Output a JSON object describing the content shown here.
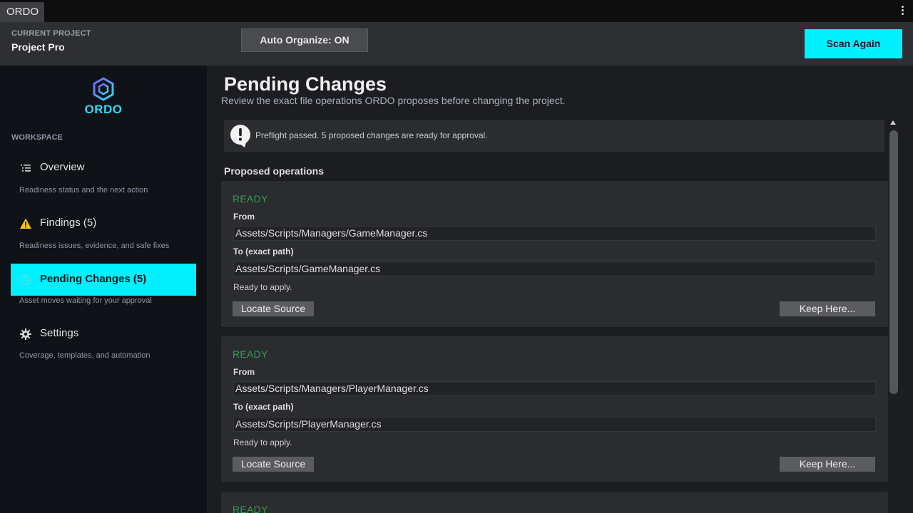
{
  "window": {
    "tab_title": "ORDO"
  },
  "project": {
    "label": "CURRENT PROJECT",
    "name": "Project Pro"
  },
  "toolbar": {
    "auto_organize_label": "Auto Organize: ON",
    "scan_label": "Scan Again"
  },
  "colors": {
    "accent": "#00f0ff",
    "ready": "#2f9e4b",
    "warning": "#f5c518",
    "logo": "#33d6f2"
  },
  "sidebar": {
    "logo_text": "ORDO",
    "section_label": "WORKSPACE",
    "items": [
      {
        "label": "Overview",
        "desc": "Readiness status and the next action",
        "icon": "list-icon",
        "active": false
      },
      {
        "label": "Findings (5)",
        "desc": "Readiness issues, evidence, and safe fixes",
        "icon": "warning-icon",
        "active": false
      },
      {
        "label": "Pending Changes (5)",
        "desc": "Asset moves waiting for your approval",
        "icon": "history-icon",
        "active": true
      },
      {
        "label": "Settings",
        "desc": "Coverage, templates, and automation",
        "icon": "gear-icon",
        "active": false
      }
    ]
  },
  "main": {
    "title": "Pending Changes",
    "subtitle": "Review the exact file operations ORDO proposes before changing the project.",
    "banner_text": "Preflight passed. 5 proposed changes are ready for approval.",
    "section_title": "Proposed operations",
    "operations": [
      {
        "status": "READY",
        "from_label": "From",
        "from": "Assets/Scripts/Managers/GameManager.cs",
        "to_label": "To (exact path)",
        "to": "Assets/Scripts/GameManager.cs",
        "note": "Ready to apply.",
        "locate_label": "Locate Source",
        "keep_label": "Keep Here..."
      },
      {
        "status": "READY",
        "from_label": "From",
        "from": "Assets/Scripts/Managers/PlayerManager.cs",
        "to_label": "To (exact path)",
        "to": "Assets/Scripts/PlayerManager.cs",
        "note": "Ready to apply.",
        "locate_label": "Locate Source",
        "keep_label": "Keep Here..."
      },
      {
        "status": "READY"
      }
    ]
  }
}
